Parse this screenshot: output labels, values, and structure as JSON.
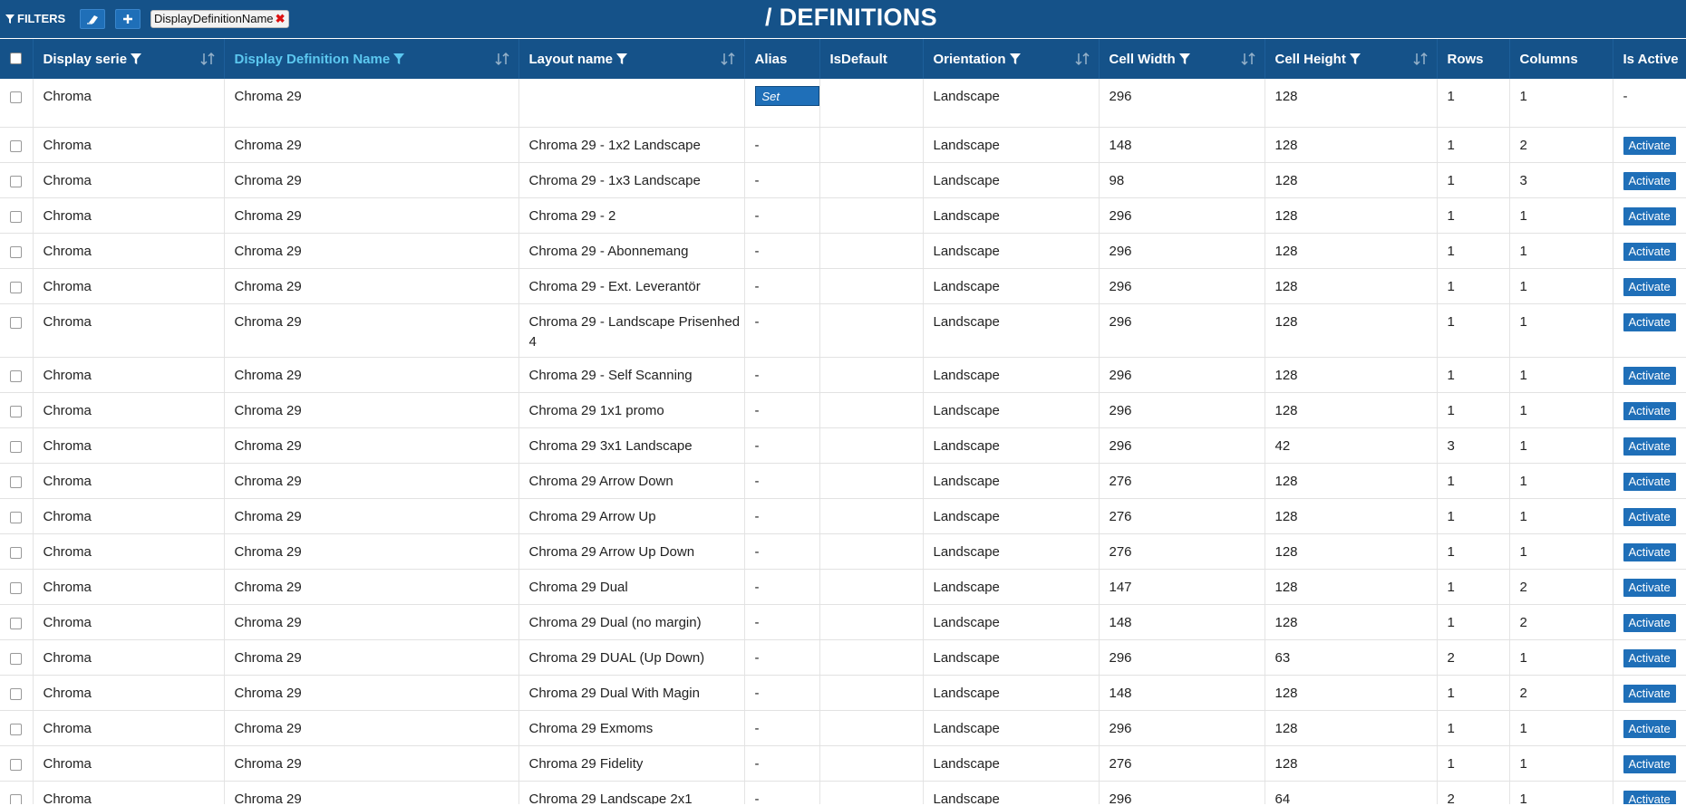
{
  "toolbar": {
    "filters_label": "FILTERS",
    "chip_label": "DisplayDefinitionName",
    "title": "/ DEFINITIONS"
  },
  "colors": {
    "header_bg": "#155289",
    "accent": "#5cc8f0",
    "button": "#1f6fb8",
    "remove": "#dd1111"
  },
  "columns": [
    {
      "key": "serie",
      "label": "Display serie"
    },
    {
      "key": "ddname",
      "label": "Display Definition Name"
    },
    {
      "key": "layout",
      "label": "Layout name"
    },
    {
      "key": "alias",
      "label": "Alias"
    },
    {
      "key": "isdefault",
      "label": "IsDefault"
    },
    {
      "key": "orientation",
      "label": "Orientation"
    },
    {
      "key": "cellw",
      "label": "Cell Width"
    },
    {
      "key": "cellh",
      "label": "Cell Height"
    },
    {
      "key": "rows",
      "label": "Rows"
    },
    {
      "key": "cols",
      "label": "Columns"
    },
    {
      "key": "active",
      "label": "Is Active"
    }
  ],
  "buttons": {
    "activate": "Activate",
    "set_alias": "Set Alias?"
  },
  "rows": [
    {
      "serie": "Chroma",
      "ddname": "Chroma 29",
      "layout": "",
      "alias": "Set Alias?",
      "isdefault": "",
      "orientation": "Landscape",
      "cellw": "296",
      "cellh": "128",
      "rows": "1",
      "cols": "1",
      "active": "-"
    },
    {
      "serie": "Chroma",
      "ddname": "Chroma 29",
      "layout": "Chroma 29 - 1x2 Landscape",
      "alias": "-",
      "isdefault": "",
      "orientation": "Landscape",
      "cellw": "148",
      "cellh": "128",
      "rows": "1",
      "cols": "2",
      "active": "Activate"
    },
    {
      "serie": "Chroma",
      "ddname": "Chroma 29",
      "layout": "Chroma 29 - 1x3 Landscape",
      "alias": "-",
      "isdefault": "",
      "orientation": "Landscape",
      "cellw": "98",
      "cellh": "128",
      "rows": "1",
      "cols": "3",
      "active": "Activate"
    },
    {
      "serie": "Chroma",
      "ddname": "Chroma 29",
      "layout": "Chroma 29 - 2",
      "alias": "-",
      "isdefault": "",
      "orientation": "Landscape",
      "cellw": "296",
      "cellh": "128",
      "rows": "1",
      "cols": "1",
      "active": "Activate"
    },
    {
      "serie": "Chroma",
      "ddname": "Chroma 29",
      "layout": "Chroma 29 - Abonnemang",
      "alias": "-",
      "isdefault": "",
      "orientation": "Landscape",
      "cellw": "296",
      "cellh": "128",
      "rows": "1",
      "cols": "1",
      "active": "Activate"
    },
    {
      "serie": "Chroma",
      "ddname": "Chroma 29",
      "layout": "Chroma 29 - Ext. Leverantör",
      "alias": "-",
      "isdefault": "",
      "orientation": "Landscape",
      "cellw": "296",
      "cellh": "128",
      "rows": "1",
      "cols": "1",
      "active": "Activate"
    },
    {
      "serie": "Chroma",
      "ddname": "Chroma 29",
      "layout": "Chroma 29 - Landscape Prisenhed 4",
      "alias": "-",
      "isdefault": "",
      "orientation": "Landscape",
      "cellw": "296",
      "cellh": "128",
      "rows": "1",
      "cols": "1",
      "active": "Activate",
      "tall": true
    },
    {
      "serie": "Chroma",
      "ddname": "Chroma 29",
      "layout": "Chroma 29 - Self Scanning",
      "alias": "-",
      "isdefault": "",
      "orientation": "Landscape",
      "cellw": "296",
      "cellh": "128",
      "rows": "1",
      "cols": "1",
      "active": "Activate"
    },
    {
      "serie": "Chroma",
      "ddname": "Chroma 29",
      "layout": "Chroma 29 1x1 promo",
      "alias": "-",
      "isdefault": "",
      "orientation": "Landscape",
      "cellw": "296",
      "cellh": "128",
      "rows": "1",
      "cols": "1",
      "active": "Activate"
    },
    {
      "serie": "Chroma",
      "ddname": "Chroma 29",
      "layout": "Chroma 29 3x1 Landscape",
      "alias": "-",
      "isdefault": "",
      "orientation": "Landscape",
      "cellw": "296",
      "cellh": "42",
      "rows": "3",
      "cols": "1",
      "active": "Activate"
    },
    {
      "serie": "Chroma",
      "ddname": "Chroma 29",
      "layout": "Chroma 29 Arrow Down",
      "alias": "-",
      "isdefault": "",
      "orientation": "Landscape",
      "cellw": "276",
      "cellh": "128",
      "rows": "1",
      "cols": "1",
      "active": "Activate"
    },
    {
      "serie": "Chroma",
      "ddname": "Chroma 29",
      "layout": "Chroma 29 Arrow Up",
      "alias": "-",
      "isdefault": "",
      "orientation": "Landscape",
      "cellw": "276",
      "cellh": "128",
      "rows": "1",
      "cols": "1",
      "active": "Activate"
    },
    {
      "serie": "Chroma",
      "ddname": "Chroma 29",
      "layout": "Chroma 29 Arrow Up Down",
      "alias": "-",
      "isdefault": "",
      "orientation": "Landscape",
      "cellw": "276",
      "cellh": "128",
      "rows": "1",
      "cols": "1",
      "active": "Activate"
    },
    {
      "serie": "Chroma",
      "ddname": "Chroma 29",
      "layout": "Chroma 29 Dual",
      "alias": "-",
      "isdefault": "",
      "orientation": "Landscape",
      "cellw": "147",
      "cellh": "128",
      "rows": "1",
      "cols": "2",
      "active": "Activate"
    },
    {
      "serie": "Chroma",
      "ddname": "Chroma 29",
      "layout": "Chroma 29 Dual (no margin)",
      "alias": "-",
      "isdefault": "",
      "orientation": "Landscape",
      "cellw": "148",
      "cellh": "128",
      "rows": "1",
      "cols": "2",
      "active": "Activate"
    },
    {
      "serie": "Chroma",
      "ddname": "Chroma 29",
      "layout": "Chroma 29 DUAL (Up Down)",
      "alias": "-",
      "isdefault": "",
      "orientation": "Landscape",
      "cellw": "296",
      "cellh": "63",
      "rows": "2",
      "cols": "1",
      "active": "Activate"
    },
    {
      "serie": "Chroma",
      "ddname": "Chroma 29",
      "layout": "Chroma 29 Dual With Magin",
      "alias": "-",
      "isdefault": "",
      "orientation": "Landscape",
      "cellw": "148",
      "cellh": "128",
      "rows": "1",
      "cols": "2",
      "active": "Activate"
    },
    {
      "serie": "Chroma",
      "ddname": "Chroma 29",
      "layout": "Chroma 29 Exmoms",
      "alias": "-",
      "isdefault": "",
      "orientation": "Landscape",
      "cellw": "296",
      "cellh": "128",
      "rows": "1",
      "cols": "1",
      "active": "Activate"
    },
    {
      "serie": "Chroma",
      "ddname": "Chroma 29",
      "layout": "Chroma 29 Fidelity",
      "alias": "-",
      "isdefault": "",
      "orientation": "Landscape",
      "cellw": "276",
      "cellh": "128",
      "rows": "1",
      "cols": "1",
      "active": "Activate"
    },
    {
      "serie": "Chroma",
      "ddname": "Chroma 29",
      "layout": "Chroma 29 Landscape 2x1",
      "alias": "-",
      "isdefault": "",
      "orientation": "Landscape",
      "cellw": "296",
      "cellh": "64",
      "rows": "2",
      "cols": "1",
      "active": "Activate"
    }
  ]
}
